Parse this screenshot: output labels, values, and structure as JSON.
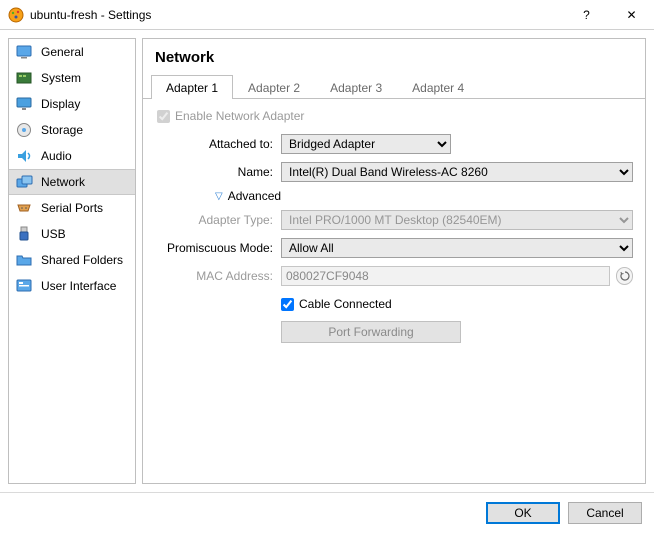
{
  "window": {
    "title": "ubuntu-fresh - Settings",
    "help": "?",
    "close": "✕"
  },
  "sidebar": {
    "items": [
      {
        "label": "General"
      },
      {
        "label": "System"
      },
      {
        "label": "Display"
      },
      {
        "label": "Storage"
      },
      {
        "label": "Audio"
      },
      {
        "label": "Network"
      },
      {
        "label": "Serial Ports"
      },
      {
        "label": "USB"
      },
      {
        "label": "Shared Folders"
      },
      {
        "label": "User Interface"
      }
    ]
  },
  "page": {
    "title": "Network"
  },
  "tabs": {
    "t1": "Adapter 1",
    "t2": "Adapter 2",
    "t3": "Adapter 3",
    "t4": "Adapter 4"
  },
  "form": {
    "enable_label": "Enable Network Adapter",
    "attached_label": "Attached to:",
    "attached_value": "Bridged Adapter",
    "name_label": "Name:",
    "name_value": "Intel(R) Dual Band Wireless-AC 8260",
    "advanced_label": "Advanced",
    "adapter_type_label": "Adapter Type:",
    "adapter_type_value": "Intel PRO/1000 MT Desktop (82540EM)",
    "promisc_label": "Promiscuous Mode:",
    "promisc_value": "Allow All",
    "mac_label": "MAC Address:",
    "mac_value": "080027CF9048",
    "cable_label": "Cable Connected",
    "port_forwarding": "Port Forwarding"
  },
  "footer": {
    "ok": "OK",
    "cancel": "Cancel"
  }
}
